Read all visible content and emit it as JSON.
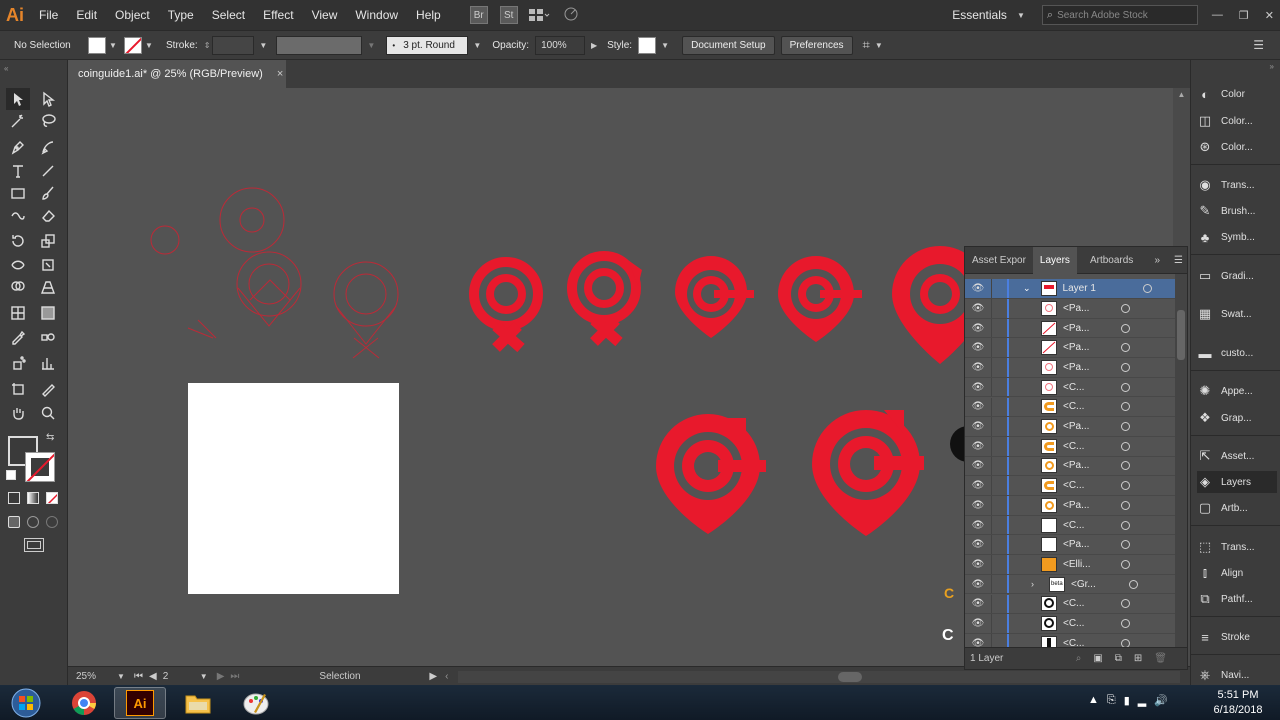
{
  "app": {
    "logo": "Ai",
    "menu": [
      "File",
      "Edit",
      "Object",
      "Type",
      "Select",
      "Effect",
      "View",
      "Window",
      "Help"
    ],
    "bridge": "Br",
    "stock_badge": "St",
    "workspace": "Essentials",
    "search_placeholder": "Search Adobe Stock"
  },
  "control_bar": {
    "selection": "No Selection",
    "stroke_label": "Stroke:",
    "brush": "3 pt. Round",
    "opacity_label": "Opacity:",
    "opacity_value": "100%",
    "style_label": "Style:",
    "document_setup": "Document Setup",
    "preferences": "Preferences"
  },
  "document": {
    "tab_title": "coinguide1.ai* @ 25% (RGB/Preview)",
    "close": "×"
  },
  "status": {
    "zoom": "25%",
    "artboard": "2",
    "tool": "Selection"
  },
  "right_dock": [
    {
      "label": "Color",
      "icon": "color-icon"
    },
    {
      "label": "Color...",
      "icon": "color-guide-icon"
    },
    {
      "label": "Color...",
      "icon": "color-themes-icon"
    },
    {
      "label": "Trans...",
      "icon": "transparency-icon"
    },
    {
      "label": "Brush...",
      "icon": "brushes-icon"
    },
    {
      "label": "Symb...",
      "icon": "symbols-icon"
    },
    {
      "label": "Gradi...",
      "icon": "gradient-icon"
    },
    {
      "label": "Swat...",
      "icon": "swatches-icon"
    },
    {
      "label": "custo...",
      "icon": "custom-icon"
    },
    {
      "label": "Appe...",
      "icon": "appearance-icon"
    },
    {
      "label": "Grap...",
      "icon": "graphic-styles-icon"
    },
    {
      "label": "Asset...",
      "icon": "asset-export-icon"
    },
    {
      "label": "Layers",
      "icon": "layers-icon"
    },
    {
      "label": "Artb...",
      "icon": "artboards-icon"
    },
    {
      "label": "Trans...",
      "icon": "transform-icon"
    },
    {
      "label": "Align",
      "icon": "align-icon"
    },
    {
      "label": "Pathf...",
      "icon": "pathfinder-icon"
    },
    {
      "label": "Stroke",
      "icon": "stroke-icon"
    },
    {
      "label": "Navi...",
      "icon": "navigator-icon"
    }
  ],
  "layers_panel": {
    "tabs": [
      "Asset Expor",
      "Layers",
      "Artboards"
    ],
    "active_tab": "Layers",
    "layer_name": "Layer 1",
    "rows": [
      "<Pa...",
      "<Pa...",
      "<Pa...",
      "<Pa...",
      "<C...",
      "<C...",
      "<Pa...",
      "<C...",
      "<Pa...",
      "<C...",
      "<Pa...",
      "<C...",
      "<Pa...",
      "<Elli...",
      "<Gr...",
      "<C...",
      "<C...",
      "<C..."
    ],
    "footer": "1 Layer"
  },
  "taskbar": {
    "time": "5:51 PM",
    "date": "6/18/2018",
    "ai_label": "Ai"
  },
  "colors": {
    "accent_red": "#e8192c",
    "ai_orange": "#e6852a",
    "selection_blue": "#4b7fe0"
  }
}
